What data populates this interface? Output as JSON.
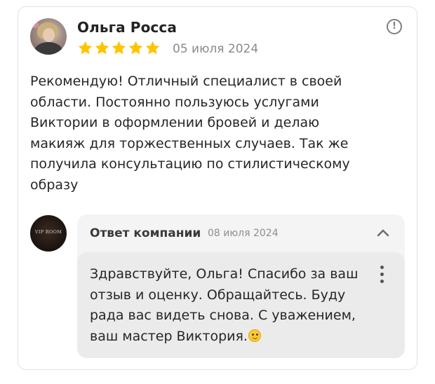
{
  "review": {
    "author": "Ольга Росса",
    "rating": 5,
    "rating_max": 5,
    "date": "05 июля 2024",
    "report_icon": "exclamation-circle-icon",
    "text_lines": [
      "Рекомендую! Отличный специалист в своей",
      "области. Постоянно пользуюсь услугами",
      "Виктории в оформлении бровей и делаю",
      "макияж для торжественных случаев. Так же",
      "получила консультацию по стилистическому",
      "образу"
    ]
  },
  "company_reply": {
    "avatar_text": "VIP ROOM",
    "title": "Ответ компании",
    "date": "08 июля 2024",
    "collapse_icon": "chevron-up-icon",
    "menu_icon": "more-vertical-icon",
    "text_lines": [
      "Здравствуйте, Ольга! Спасибо за ваш",
      "отзыв и оценку. Обращайтесь. Буду",
      "рада вас видеть снова. С уважением,",
      "ваш мастер Виктория."
    ],
    "emoji": "smiling-face-emoji"
  },
  "colors": {
    "star": "#ffc400",
    "reply_bg": "#f4f4f4",
    "reply_inner_bg": "#ebebeb",
    "border": "#e3e3e3"
  }
}
